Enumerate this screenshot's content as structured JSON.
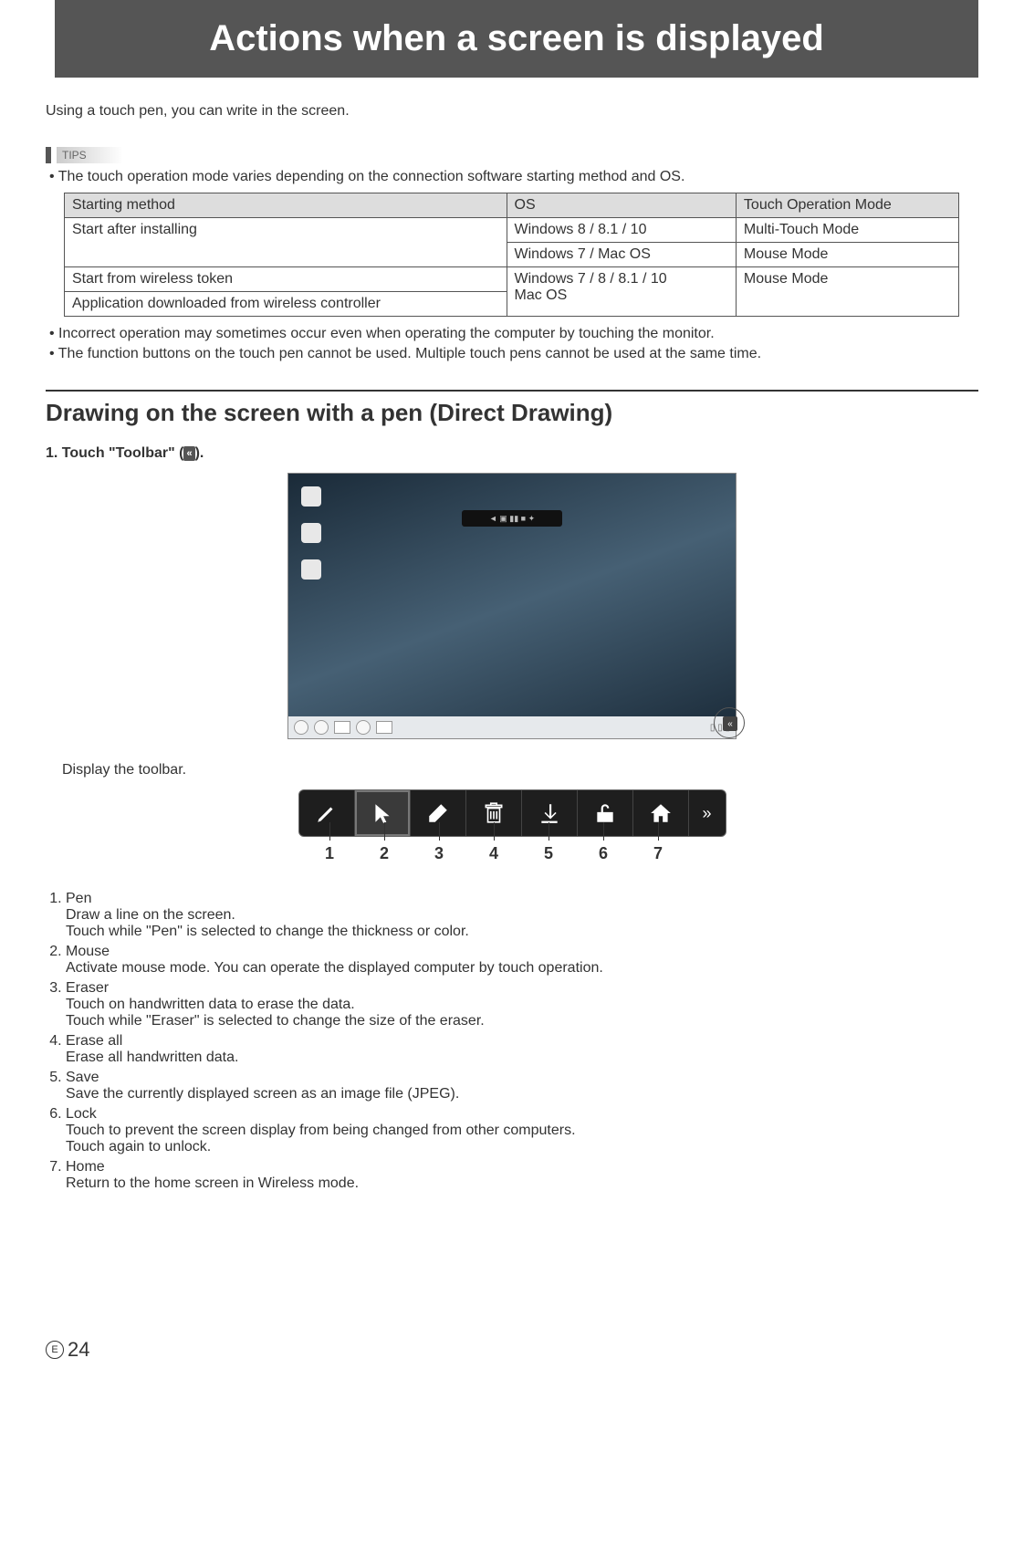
{
  "title": "Actions when a screen is displayed",
  "intro": "Using a touch pen, you can write in the screen.",
  "tips_label": "TIPS",
  "tips_intro": "The touch operation mode varies depending on the connection software starting method and OS.",
  "table": {
    "headers": {
      "h1": "Starting method",
      "h2": "OS",
      "h3": "Touch Operation Mode"
    },
    "r1": {
      "c1": "Start after installing",
      "c2": "Windows 8 / 8.1 / 10",
      "c3": "Multi-Touch Mode"
    },
    "r2": {
      "c2": "Windows 7 / Mac OS",
      "c3": "Mouse Mode"
    },
    "r3": {
      "c1": "Start from wireless token",
      "c2": "Windows 7 / 8 / 8.1 / 10\nMac OS",
      "c3": "Mouse Mode"
    },
    "r4": {
      "c1": "Application downloaded from wireless controller"
    }
  },
  "tips_bullets": {
    "b1": "Incorrect operation may sometimes occur even when operating the computer by touching the monitor.",
    "b2": "The function buttons on the touch pen cannot be used. Multiple touch pens cannot be used at the same time."
  },
  "section_title": "Drawing on the screen with a pen (Direct Drawing)",
  "step1_prefix": "1. Touch \"Toolbar\" (",
  "step1_icon": "«",
  "step1_suffix": ").",
  "display_toolbar": "Display the toolbar.",
  "toolbar_collapse": "»",
  "numbers": {
    "n1": "1",
    "n2": "2",
    "n3": "3",
    "n4": "4",
    "n5": "5",
    "n6": "6",
    "n7": "7"
  },
  "tools": [
    {
      "name": "Pen",
      "desc": "Draw a line on the screen.\nTouch while \"Pen\" is selected to change the thickness or color."
    },
    {
      "name": "Mouse",
      "desc": "Activate mouse mode. You can operate the displayed computer by touch operation."
    },
    {
      "name": "Eraser",
      "desc": "Touch on handwritten data to erase the data.\nTouch while \"Eraser\" is selected to change the size of the eraser."
    },
    {
      "name": "Erase all",
      "desc": "Erase all handwritten data."
    },
    {
      "name": "Save",
      "desc": "Save the currently displayed screen as an image file (JPEG)."
    },
    {
      "name": "Lock",
      "desc": "Touch to prevent the screen display from being changed from other computers.\nTouch again to unlock."
    },
    {
      "name": "Home",
      "desc": "Return to the home screen in Wireless mode."
    }
  ],
  "page_number_prefix": "E",
  "page_number": "24"
}
